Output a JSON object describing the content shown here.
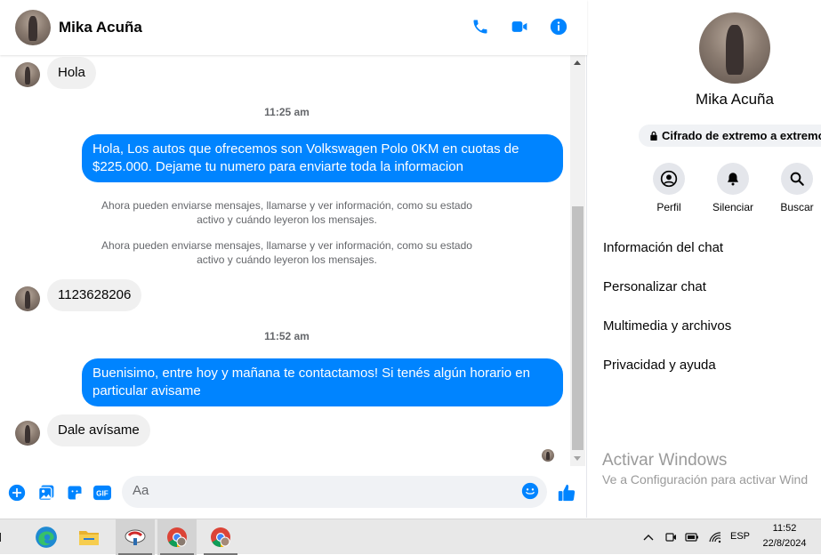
{
  "header": {
    "contact_name": "Mika Acuña",
    "icons": [
      "phone-icon",
      "video-icon",
      "info-icon"
    ]
  },
  "messages": [
    {
      "type": "incoming",
      "text": "Hola"
    },
    {
      "type": "timestamp",
      "text": "11:25 am"
    },
    {
      "type": "outgoing",
      "text": "Hola, Los autos que ofrecemos son Volkswagen Polo 0KM en cuotas de $225.000. Dejame tu numero para enviarte toda la informacion"
    },
    {
      "type": "system",
      "text": "Ahora pueden enviarse mensajes, llamarse y ver información, como su estado activo y cuándo leyeron los mensajes."
    },
    {
      "type": "system",
      "text": "Ahora pueden enviarse mensajes, llamarse y ver información, como su estado activo y cuándo leyeron los mensajes."
    },
    {
      "type": "incoming",
      "text": "1123628206"
    },
    {
      "type": "timestamp",
      "text": "11:52 am"
    },
    {
      "type": "outgoing",
      "text": "Buenisimo, entre hoy y mañana te contactamos! Si tenés algún horario en particular avisame"
    },
    {
      "type": "incoming",
      "text": "Dale avísame"
    }
  ],
  "composer": {
    "placeholder": "Aa",
    "icons": [
      "plus-icon",
      "gallery-icon",
      "sticker-icon",
      "gif-icon",
      "emoji-icon",
      "like-icon"
    ],
    "gif_label": "GIF"
  },
  "info_panel": {
    "name": "Mika Acuña",
    "encryption": "Cifrado de extremo a extremo",
    "actions": [
      {
        "label": "Perfil",
        "icon": "profile-icon"
      },
      {
        "label": "Silenciar",
        "icon": "bell-icon"
      },
      {
        "label": "Buscar",
        "icon": "search-icon"
      }
    ],
    "menu": [
      "Información del chat",
      "Personalizar chat",
      "Multimedia y archivos",
      "Privacidad y ayuda"
    ]
  },
  "watermark": {
    "title": "Activar Windows",
    "subtitle": "Ve a Configuración para activar Wind"
  },
  "taskbar": {
    "apps": [
      "edge-icon",
      "file-explorer-icon",
      "app-icon",
      "chrome-icon",
      "chrome-icon"
    ],
    "language": "ESP",
    "time": "11:52",
    "date": "22/8/2024"
  },
  "colors": {
    "messenger_blue": "#0084ff",
    "incoming_bubble": "#f0f0f0",
    "muted_text": "#65676b"
  }
}
